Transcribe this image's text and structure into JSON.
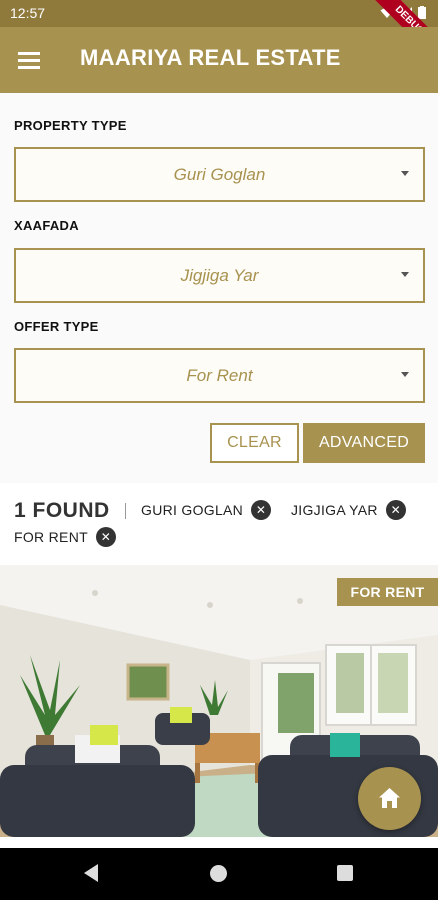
{
  "status_bar": {
    "time": "12:57",
    "debug_label": "DEBUG"
  },
  "app_bar": {
    "title": "MAARIYA REAL ESTATE",
    "menu_icon": "menu-icon"
  },
  "filters": {
    "property_type": {
      "label": "PROPERTY TYPE",
      "value": "Guri Goglan"
    },
    "xaafada": {
      "label": "XAAFADA",
      "value": "Jigjiga Yar"
    },
    "offer_type": {
      "label": "OFFER TYPE",
      "value": "For Rent"
    },
    "clear_label": "CLEAR",
    "advanced_label": "ADVANCED"
  },
  "results": {
    "found_label": "1 FOUND",
    "chips": [
      "GURI GOGLAN",
      "JIGJIGA YAR",
      "FOR RENT"
    ],
    "chip_close_icon": "close-circle-icon"
  },
  "listing": {
    "badge": "FOR RENT",
    "image": "living-room-photo"
  },
  "fab": {
    "icon": "home-icon"
  },
  "colors": {
    "accent": "#a8924f",
    "status_bar": "#8f7a3c",
    "debug": "#b00020"
  }
}
